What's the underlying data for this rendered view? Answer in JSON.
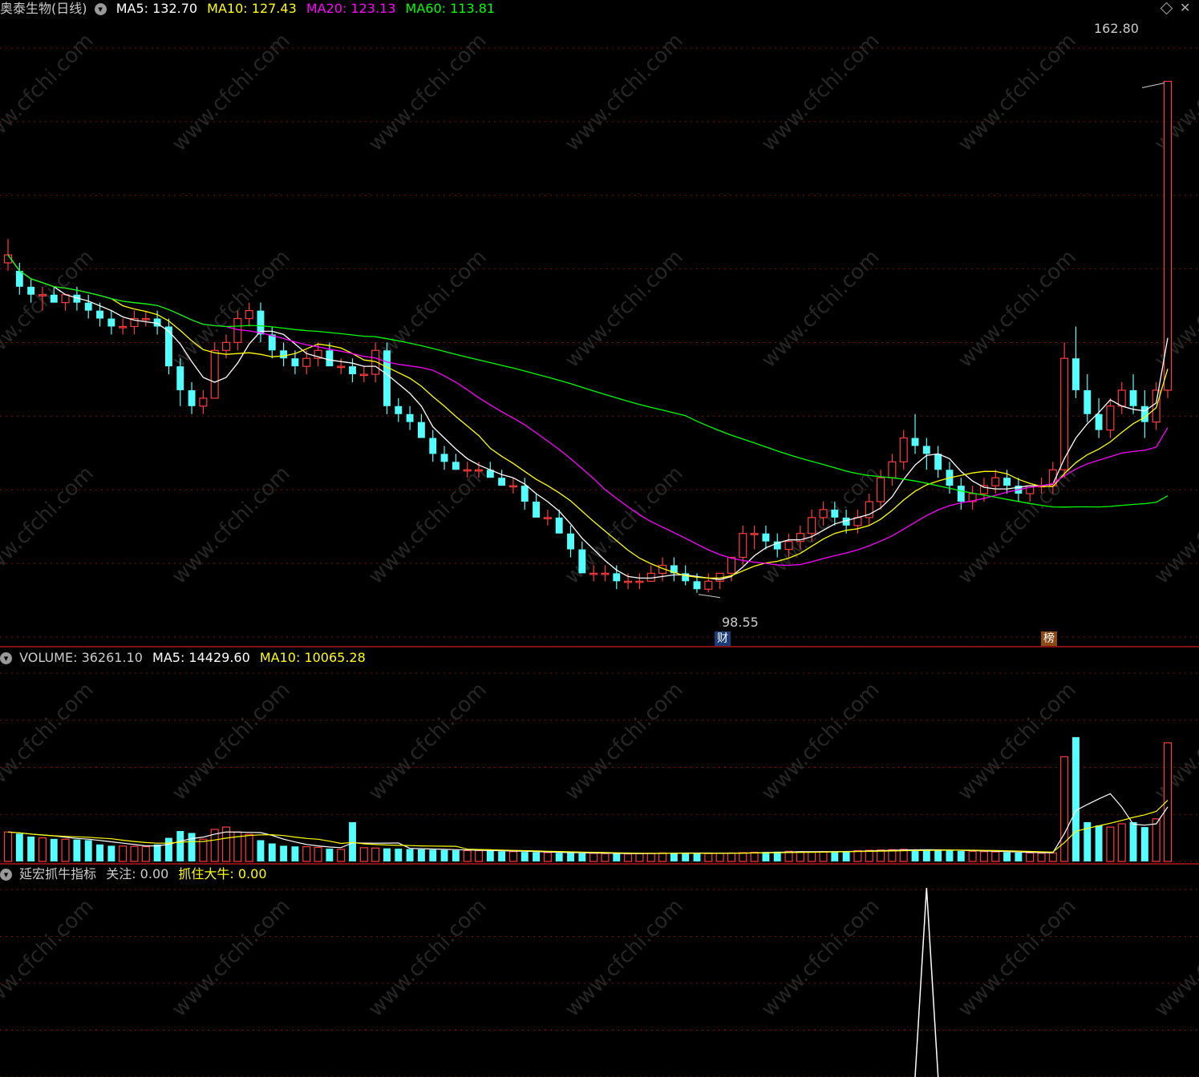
{
  "header": {
    "stock_title": "奥泰生物(日线)",
    "ma5_label": "MA5: 132.70",
    "ma10_label": "MA10: 127.43",
    "ma20_label": "MA20: 123.13",
    "ma60_label": "MA60: 113.81"
  },
  "volume_header": {
    "title": "VOLUME: 36261.10",
    "ma5_label": "MA5: 14429.60",
    "ma10_label": "MA10: 10065.28"
  },
  "indicator_header": {
    "title": "延宏抓牛指标",
    "focus_label": "关注: 0.00",
    "bull_label": "抓住大牛: 0.00"
  },
  "price_annotations": {
    "high_label": "162.80",
    "low_label": "98.55",
    "fin_badge": "财",
    "rank_badge": "榜"
  },
  "watermark": "www.cfchi.com",
  "colors": {
    "up": "#ff3b3b",
    "down": "#54ffff",
    "ma5": "#ffffff",
    "ma10": "#ffff00",
    "ma20": "#ff00ff",
    "ma60": "#00ff00",
    "grid": "#7a1010",
    "divider": "#b01818"
  },
  "icons": {
    "collapse": "chevron-down-icon",
    "diamond": "diamond-icon",
    "close": "close-icon"
  },
  "chart_data": {
    "type": "candlestick",
    "price_range": [
      95,
      170
    ],
    "candles": [
      [
        140,
        143,
        139,
        141
      ],
      [
        139,
        140,
        136,
        137
      ],
      [
        137,
        138,
        135,
        136
      ],
      [
        136,
        137,
        134,
        136
      ],
      [
        136,
        137,
        135,
        135
      ],
      [
        135,
        136,
        134,
        136
      ],
      [
        136,
        137,
        134,
        135
      ],
      [
        135,
        136,
        133,
        134
      ],
      [
        134,
        135,
        132,
        133
      ],
      [
        133,
        134,
        131,
        132
      ],
      [
        132,
        133,
        131,
        132
      ],
      [
        132,
        134,
        131,
        133
      ],
      [
        133,
        134,
        132,
        133
      ],
      [
        133,
        134,
        131,
        132
      ],
      [
        132,
        133,
        126,
        127
      ],
      [
        127,
        128,
        122,
        124
      ],
      [
        124,
        125,
        121,
        122
      ],
      [
        122,
        124,
        121,
        123
      ],
      [
        123,
        130,
        123,
        129
      ],
      [
        129,
        131,
        128,
        130
      ],
      [
        130,
        134,
        129,
        133
      ],
      [
        133,
        135,
        132,
        134
      ],
      [
        134,
        135,
        130,
        131
      ],
      [
        131,
        132,
        128,
        129
      ],
      [
        129,
        130,
        127,
        128
      ],
      [
        128,
        129,
        126,
        127
      ],
      [
        127,
        129,
        126,
        128
      ],
      [
        128,
        130,
        127,
        129
      ],
      [
        129,
        130,
        127,
        127
      ],
      [
        127,
        128,
        126,
        127
      ],
      [
        127,
        128,
        125,
        126
      ],
      [
        126,
        127,
        125,
        126
      ],
      [
        126,
        130,
        125,
        129
      ],
      [
        129,
        130,
        121,
        122
      ],
      [
        122,
        123,
        120,
        121
      ],
      [
        121,
        122,
        119,
        120
      ],
      [
        120,
        121,
        118,
        118
      ],
      [
        118,
        119,
        115,
        116
      ],
      [
        116,
        117,
        114,
        115
      ],
      [
        115,
        116,
        114,
        114
      ],
      [
        114,
        115,
        113,
        114
      ],
      [
        114,
        115,
        113,
        114
      ],
      [
        114,
        115,
        113,
        113
      ],
      [
        113,
        114,
        112,
        112
      ],
      [
        112,
        113,
        111,
        112
      ],
      [
        112,
        113,
        109,
        110
      ],
      [
        110,
        111,
        108,
        108
      ],
      [
        108,
        109,
        107,
        108
      ],
      [
        108,
        109,
        106,
        106
      ],
      [
        106,
        107,
        103,
        104
      ],
      [
        104,
        105,
        101,
        101
      ],
      [
        101,
        102,
        100,
        101
      ],
      [
        101,
        102,
        100,
        101
      ],
      [
        101,
        102,
        99,
        100
      ],
      [
        100,
        101,
        99,
        100
      ],
      [
        100,
        101,
        99,
        100
      ],
      [
        100,
        102,
        100,
        101
      ],
      [
        101,
        103,
        100,
        102
      ],
      [
        102,
        103,
        100,
        101
      ],
      [
        101,
        102,
        99.5,
        100
      ],
      [
        100,
        101,
        98.55,
        99
      ],
      [
        99,
        101,
        98.6,
        100
      ],
      [
        100,
        101,
        99,
        101
      ],
      [
        101,
        103,
        100,
        103
      ],
      [
        103,
        107,
        102,
        106
      ],
      [
        106,
        107,
        104,
        106
      ],
      [
        106,
        107,
        104,
        105
      ],
      [
        105,
        106,
        103,
        104
      ],
      [
        104,
        106,
        103,
        105
      ],
      [
        105,
        107,
        104,
        106
      ],
      [
        106,
        109,
        105,
        108
      ],
      [
        108,
        110,
        107,
        109
      ],
      [
        109,
        110,
        107,
        108
      ],
      [
        108,
        109,
        106,
        107
      ],
      [
        107,
        109,
        106,
        108
      ],
      [
        108,
        111,
        107,
        110
      ],
      [
        110,
        114,
        109,
        113
      ],
      [
        113,
        116,
        112,
        115
      ],
      [
        115,
        119,
        114,
        118
      ],
      [
        118,
        121,
        116,
        117
      ],
      [
        117,
        118,
        114,
        116
      ],
      [
        116,
        117,
        113,
        114
      ],
      [
        114,
        115,
        111,
        112
      ],
      [
        112,
        113,
        109,
        110
      ],
      [
        110,
        112,
        109,
        111
      ],
      [
        111,
        113,
        110,
        112
      ],
      [
        112,
        114,
        111,
        113
      ],
      [
        113,
        114,
        111,
        112
      ],
      [
        112,
        113,
        110,
        111
      ],
      [
        111,
        112,
        110,
        112
      ],
      [
        112,
        113,
        111,
        112
      ],
      [
        112,
        115,
        111,
        114
      ],
      [
        114,
        130,
        113,
        128
      ],
      [
        128,
        132,
        123,
        124
      ],
      [
        124,
        126,
        120,
        121
      ],
      [
        121,
        123,
        118,
        119
      ],
      [
        119,
        123,
        118,
        122
      ],
      [
        122,
        125,
        121,
        124
      ],
      [
        124,
        126,
        121,
        122
      ],
      [
        122,
        124,
        118,
        120
      ],
      [
        120,
        125,
        119,
        124
      ],
      [
        124,
        162.8,
        123,
        162.8
      ]
    ],
    "volume_range": [
      0,
      60000
    ],
    "volumes": [
      9000,
      8500,
      7600,
      7200,
      6900,
      6800,
      6700,
      6500,
      5200,
      4800,
      4700,
      4600,
      4500,
      5200,
      7200,
      9300,
      8700,
      6800,
      9800,
      10500,
      9000,
      8300,
      6500,
      5500,
      4800,
      4600,
      4500,
      4300,
      3900,
      3700,
      12000,
      4200,
      4100,
      4000,
      3900,
      3800,
      3700,
      3600,
      3500,
      3400,
      3300,
      3300,
      3200,
      3100,
      3000,
      2900,
      2800,
      2700,
      2600,
      2600,
      2500,
      2500,
      2400,
      2400,
      2300,
      2400,
      2500,
      2600,
      2700,
      2600,
      2500,
      2400,
      2500,
      2600,
      2700,
      2800,
      2900,
      3000,
      3100,
      3000,
      2900,
      3000,
      3100,
      3200,
      3300,
      3400,
      3500,
      3600,
      3700,
      3600,
      3500,
      3400,
      3300,
      3200,
      3100,
      3000,
      2900,
      2800,
      2700,
      2600,
      2500,
      2600,
      32000,
      38000,
      12000,
      11000,
      10500,
      11500,
      12000,
      10500,
      13000,
      36261.1
    ],
    "indicator": {
      "peak_index": 80,
      "peak_value": 1.0
    },
    "y_labels": {
      "high": 162.8,
      "low": 98.55
    }
  }
}
